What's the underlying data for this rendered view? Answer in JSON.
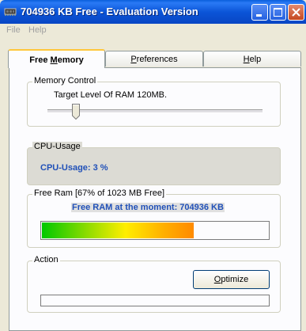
{
  "window": {
    "title": "704936 KB Free - Evaluation Version",
    "buttons": [
      "minimize",
      "maximize",
      "close"
    ]
  },
  "menu": {
    "items": [
      "File",
      "Help"
    ]
  },
  "tabs": [
    {
      "label": "Free Memory",
      "mnemonic": "M",
      "active": true
    },
    {
      "label": "Preferences",
      "mnemonic": "P",
      "active": false
    },
    {
      "label": "Help",
      "mnemonic": "H",
      "active": false
    }
  ],
  "memory_control": {
    "legend": "Memory Control",
    "target_label": "Target Level Of RAM 120MB.",
    "slider_value_fraction": 0.12
  },
  "cpu_usage": {
    "legend": "CPU-Usage",
    "text": "CPU-Usage: 3 %"
  },
  "free_ram": {
    "legend": "Free Ram [67% of 1023 MB Free]",
    "text": "Free RAM at the moment: 704936 KB",
    "progress_percent": 67
  },
  "action": {
    "legend": "Action",
    "optimize_button": "Optimize",
    "optimize_mnemonic": "O",
    "progress_percent": 0
  },
  "colors": {
    "title_bar": "#0b55d8",
    "status_text": "#2050b8",
    "panel_bg": "#fcfcfe",
    "window_bg": "#ece9d8"
  },
  "icons": {
    "app": "memory-chip-icon",
    "minimize": "minimize-icon",
    "maximize": "maximize-icon",
    "close": "close-icon"
  }
}
